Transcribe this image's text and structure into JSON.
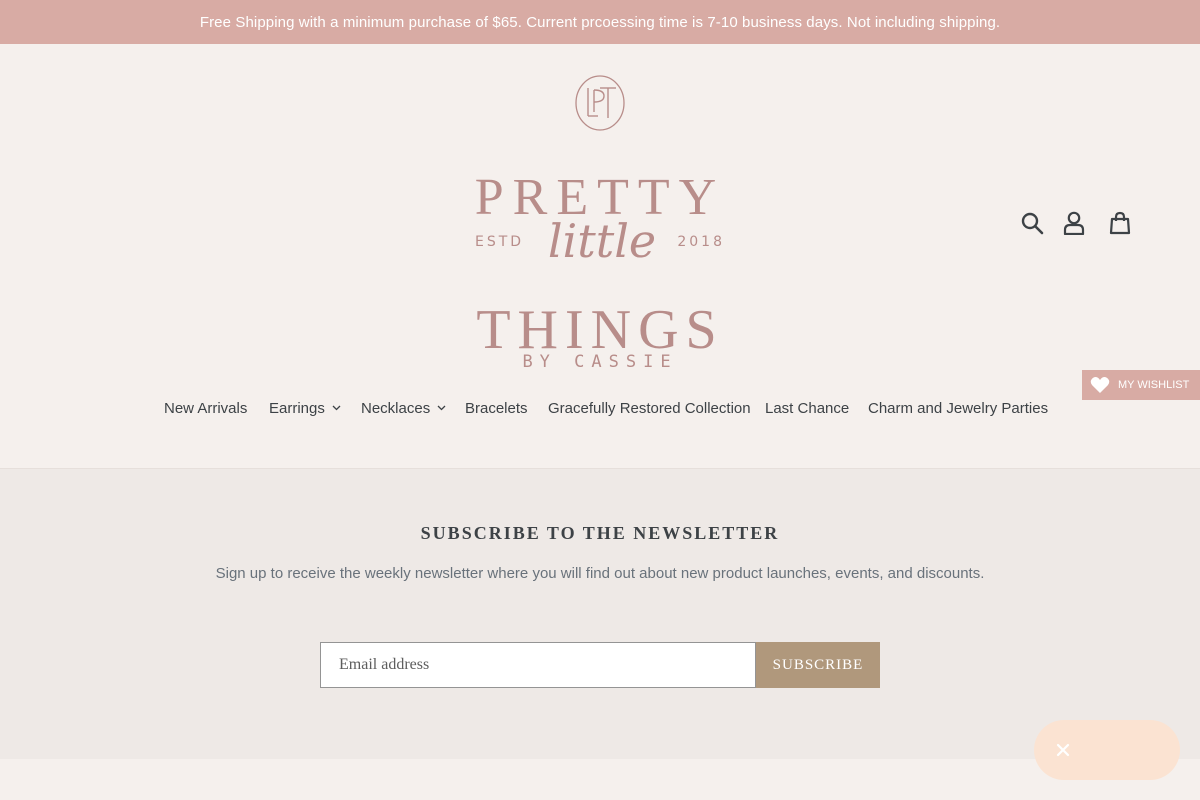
{
  "announcement": {
    "text": "Free Shipping with a minimum purchase of $65. Current prcoessing time is 7-10 business days. Not including shipping."
  },
  "logo": {
    "monogram": "LPT",
    "line1": "PRETTY",
    "estd": "ESTD",
    "script": "little",
    "year": "2018",
    "line2": "THINGS",
    "byline": "BY CASSIE"
  },
  "header_icons": [
    "search-icon",
    "account-icon",
    "cart-icon"
  ],
  "wishlist": {
    "label": "MY WISHLIST",
    "icon": "heart-icon"
  },
  "nav": {
    "items": [
      {
        "label": "New Arrivals",
        "dropdown": false
      },
      {
        "label": "Earrings",
        "dropdown": true
      },
      {
        "label": "Necklaces",
        "dropdown": true
      },
      {
        "label": "Bracelets",
        "dropdown": false
      },
      {
        "label": "Gracefully Restored Collection",
        "dropdown": false
      },
      {
        "label": "Last Chance",
        "dropdown": false
      },
      {
        "label": "Charm and Jewelry Parties",
        "dropdown": false
      }
    ]
  },
  "newsletter": {
    "title": "SUBSCRIBE TO THE NEWSLETTER",
    "text": "Sign up to receive the weekly newsletter where you will find out about new product launches, events, and discounts.",
    "email_placeholder": "Email address",
    "button_label": "SUBSCRIBE"
  },
  "chat": {
    "icon": "close-icon"
  },
  "colors": {
    "announcement_bg": "#d8aba4",
    "page_bg": "#f5f0ed",
    "newsletter_bg": "#eee9e6",
    "logo": "#b88d8a",
    "button_bg": "#b0987c",
    "chat_bg": "#fbe3d2"
  }
}
